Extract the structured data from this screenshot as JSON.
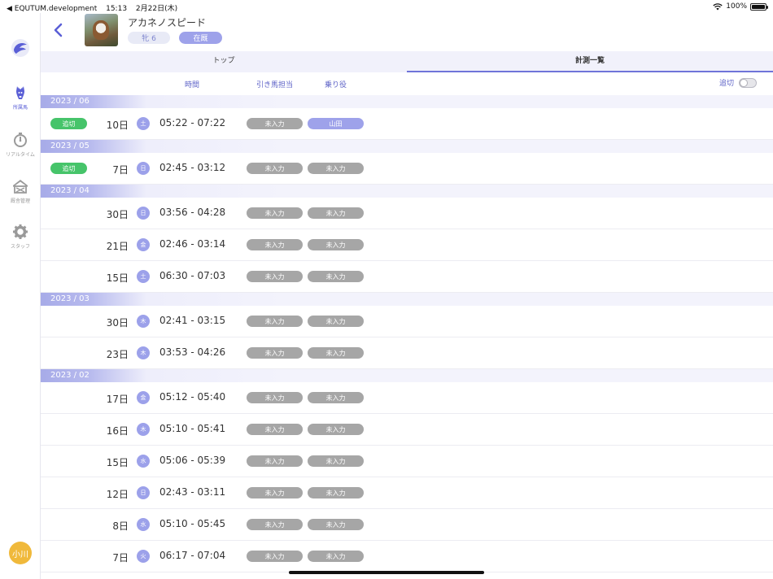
{
  "status_bar": {
    "app": "◀ EQUTUM.development",
    "time": "15:13",
    "date": "2月22日(木)",
    "battery": "100%"
  },
  "sidebar": {
    "items": [
      {
        "label": "所属馬",
        "icon": "horse-icon",
        "active": true
      },
      {
        "label": "リアルタイム",
        "icon": "stopwatch-icon",
        "active": false
      },
      {
        "label": "厩舎管理",
        "icon": "stable-icon",
        "active": false
      },
      {
        "label": "スタッフ",
        "icon": "gear-icon",
        "active": false
      }
    ],
    "user_initials": "小川"
  },
  "header": {
    "horse_name": "アカネノスピード",
    "gender_age": "牝 6",
    "status": "在厩"
  },
  "tabs": [
    {
      "label": "トップ",
      "active": false
    },
    {
      "label": "計測一覧",
      "active": true
    }
  ],
  "columns": {
    "time": "時間",
    "handler": "引き馬担当",
    "rider": "乗り役",
    "cut_toggle_label": "追切",
    "cut_toggle_on": false
  },
  "colors": {
    "accent": "#6f74d9",
    "cut_tag": "#46c46a",
    "unassigned": "#a6a6a6",
    "assigned": "#9ea2ea"
  },
  "months": [
    {
      "label": "2023 / 06",
      "rows": [
        {
          "cut": "追切",
          "day": "10日",
          "dow": "土",
          "time": "05:22 - 07:22",
          "handler": "未入力",
          "rider": "山田",
          "rider_assigned": true
        }
      ]
    },
    {
      "label": "2023 / 05",
      "rows": [
        {
          "cut": "追切",
          "day": "7日",
          "dow": "日",
          "time": "02:45 - 03:12",
          "handler": "未入力",
          "rider": "未入力",
          "rider_assigned": false
        }
      ]
    },
    {
      "label": "2023 / 04",
      "rows": [
        {
          "cut": "",
          "day": "30日",
          "dow": "日",
          "time": "03:56 - 04:28",
          "handler": "未入力",
          "rider": "未入力",
          "rider_assigned": false
        },
        {
          "cut": "",
          "day": "21日",
          "dow": "金",
          "time": "02:46 - 03:14",
          "handler": "未入力",
          "rider": "未入力",
          "rider_assigned": false
        },
        {
          "cut": "",
          "day": "15日",
          "dow": "土",
          "time": "06:30 - 07:03",
          "handler": "未入力",
          "rider": "未入力",
          "rider_assigned": false
        }
      ]
    },
    {
      "label": "2023 / 03",
      "rows": [
        {
          "cut": "",
          "day": "30日",
          "dow": "木",
          "time": "02:41 - 03:15",
          "handler": "未入力",
          "rider": "未入力",
          "rider_assigned": false
        },
        {
          "cut": "",
          "day": "23日",
          "dow": "木",
          "time": "03:53 - 04:26",
          "handler": "未入力",
          "rider": "未入力",
          "rider_assigned": false
        }
      ]
    },
    {
      "label": "2023 / 02",
      "rows": [
        {
          "cut": "",
          "day": "17日",
          "dow": "金",
          "time": "05:12 - 05:40",
          "handler": "未入力",
          "rider": "未入力",
          "rider_assigned": false
        },
        {
          "cut": "",
          "day": "16日",
          "dow": "木",
          "time": "05:10 - 05:41",
          "handler": "未入力",
          "rider": "未入力",
          "rider_assigned": false
        },
        {
          "cut": "",
          "day": "15日",
          "dow": "水",
          "time": "05:06 - 05:39",
          "handler": "未入力",
          "rider": "未入力",
          "rider_assigned": false
        },
        {
          "cut": "",
          "day": "12日",
          "dow": "日",
          "time": "02:43 - 03:11",
          "handler": "未入力",
          "rider": "未入力",
          "rider_assigned": false
        },
        {
          "cut": "",
          "day": "8日",
          "dow": "水",
          "time": "05:10 - 05:45",
          "handler": "未入力",
          "rider": "未入力",
          "rider_assigned": false
        },
        {
          "cut": "",
          "day": "7日",
          "dow": "火",
          "time": "06:17 - 07:04",
          "handler": "未入力",
          "rider": "未入力",
          "rider_assigned": false
        }
      ]
    }
  ]
}
